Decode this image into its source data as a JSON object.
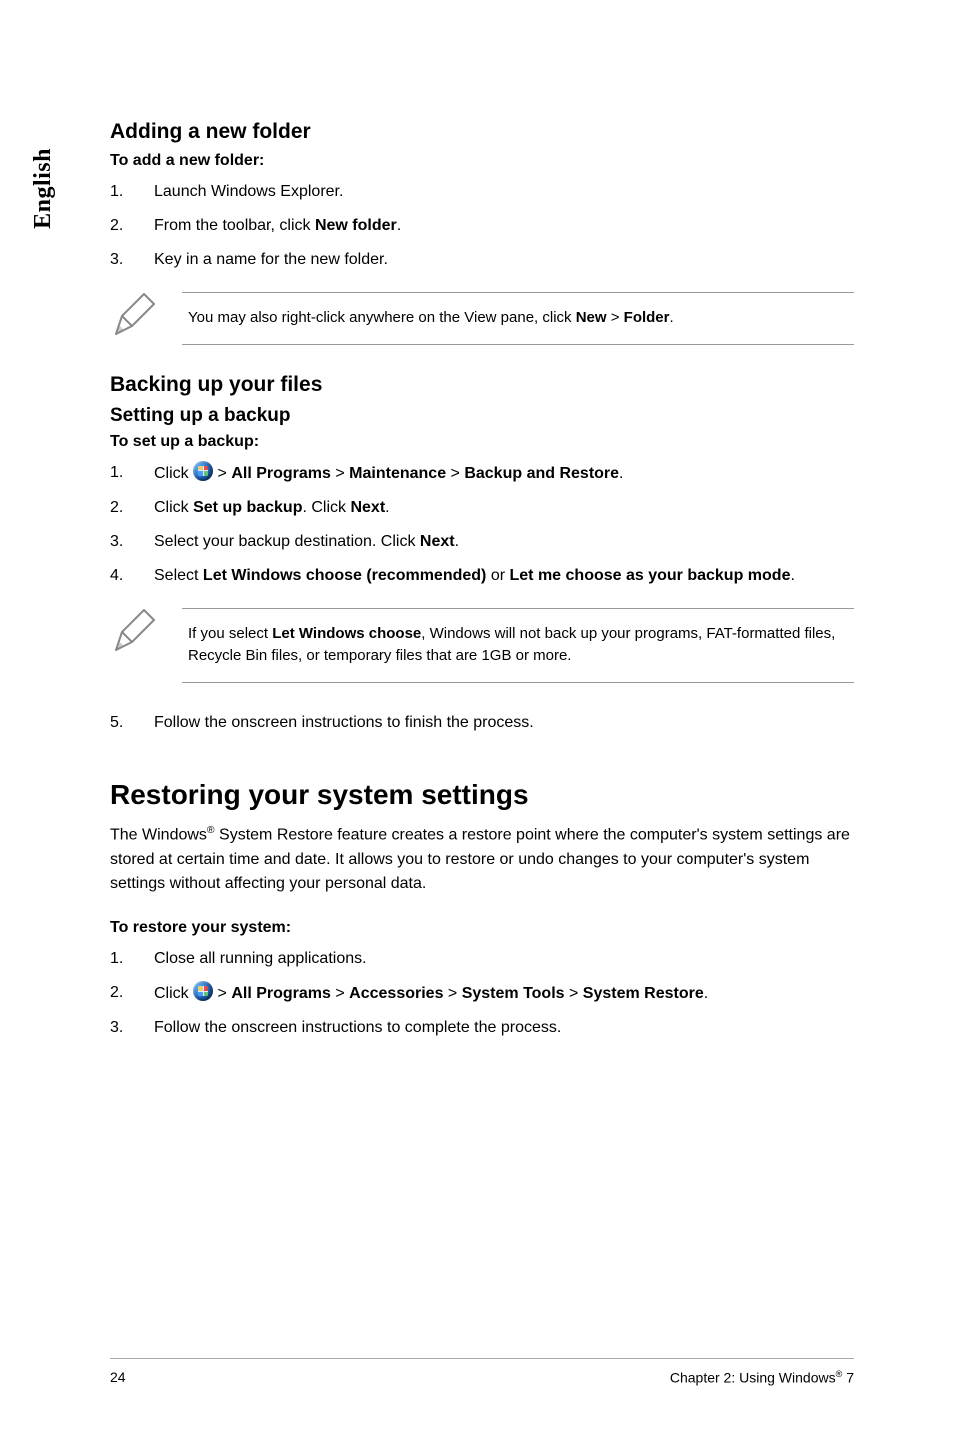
{
  "sideLabel": "English",
  "section1": {
    "heading": "Adding a new folder",
    "lead": "To add a new folder:",
    "steps": [
      {
        "text": "Launch Windows Explorer."
      },
      {
        "pre": "From the toolbar, click ",
        "b1": "New folder",
        "post": "."
      },
      {
        "text": "Key in a name for the new folder."
      }
    ],
    "note": {
      "pre": "You may also right-click anywhere on the View pane, click ",
      "b1": "New",
      "sep": " > ",
      "b2": "Folder",
      "post": "."
    }
  },
  "section2": {
    "heading": "Backing up your files",
    "sub": "Setting up a backup",
    "lead": "To set up a backup:",
    "steps": [
      {
        "pre": "Click ",
        "icon": true,
        "mid": " > ",
        "b1": "All Programs",
        "sep1": " > ",
        "b2": "Maintenance",
        "sep2": " > ",
        "b3": "Backup and Restore",
        "post": "."
      },
      {
        "pre": "Click ",
        "b1": "Set up backup",
        "mid": ". Click ",
        "b2": "Next",
        "post": "."
      },
      {
        "pre": "Select your backup destination. Click ",
        "b1": "Next",
        "post": "."
      },
      {
        "pre": "Select ",
        "b1": "Let Windows choose (recommended)",
        "mid": " or ",
        "b2": "Let me choose as your backup mode",
        "post": "."
      }
    ],
    "note": {
      "pre": "If you select ",
      "b1": "Let Windows choose",
      "post": ", Windows will not back up your programs, FAT-formatted files, Recycle Bin files, or temporary files that are 1GB or more."
    },
    "step5": {
      "num": "5.",
      "text": "Follow the onscreen instructions to finish the process."
    }
  },
  "section3": {
    "heading": "Restoring your system settings",
    "para": {
      "pre": "The Windows",
      "reg": "®",
      "post": " System Restore feature creates a restore point where the computer's system settings are stored at certain time and date. It allows you to restore or undo changes to your computer's system settings without affecting your personal data."
    },
    "lead": "To restore your system:",
    "steps": [
      {
        "text": "Close all running applications."
      },
      {
        "pre": "Click ",
        "icon": true,
        "mid": " > ",
        "b1": "All Programs",
        "sep1": " > ",
        "b2": "Accessories",
        "sep2": " > ",
        "b3": "System Tools",
        "sep3": " > ",
        "b4": "System Restore",
        "post": "."
      },
      {
        "text": "Follow the onscreen instructions to complete the process."
      }
    ]
  },
  "footer": {
    "pageNum": "24",
    "chapterPre": "Chapter 2: Using Windows",
    "reg": "®",
    "chapterPost": " 7"
  }
}
